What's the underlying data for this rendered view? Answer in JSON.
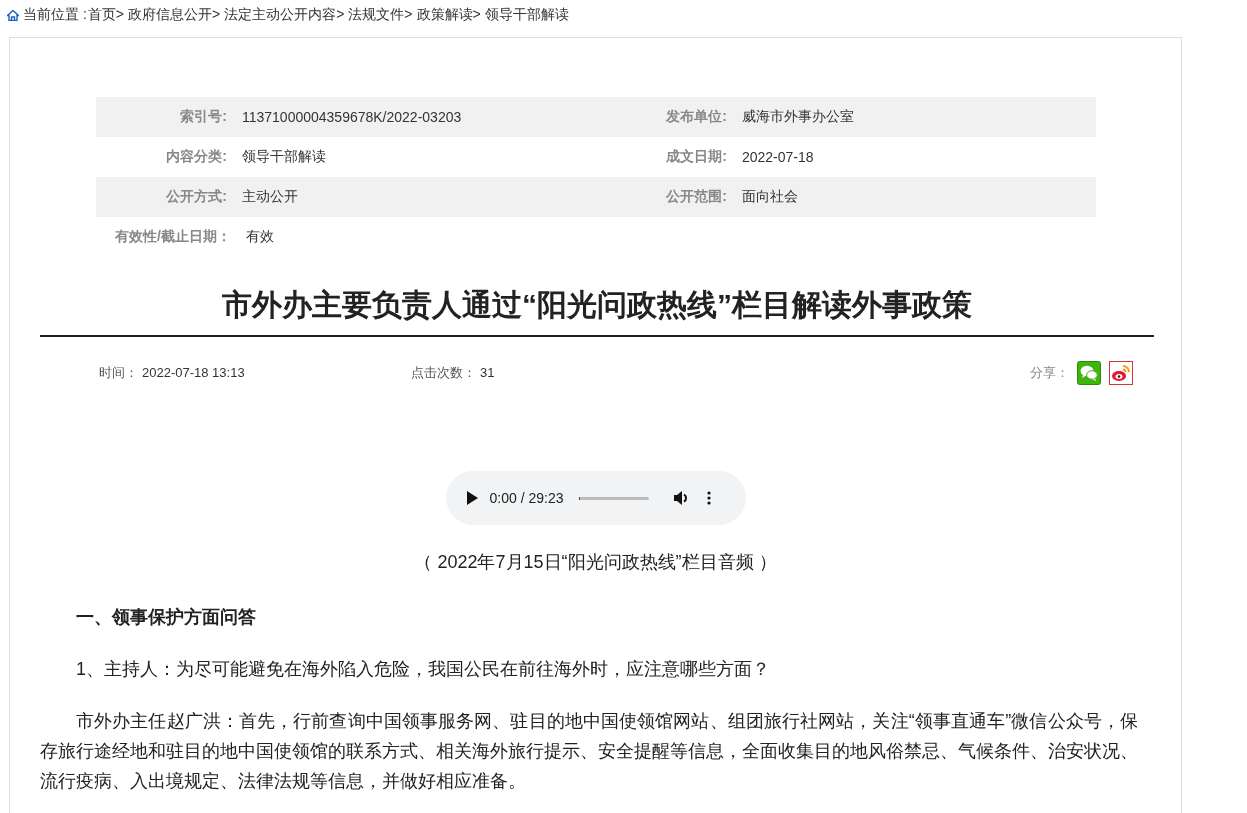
{
  "breadcrumb": {
    "label": "当前位置 :",
    "items": [
      "首页>",
      "政府信息公开>",
      "法定主动公开内容>",
      "法规文件>",
      "政策解读>",
      "领导干部解读"
    ]
  },
  "meta": [
    {
      "label": "索引号:",
      "value": "11371000004359678K/2022-03203",
      "label_2": "发布单位:",
      "value_2": "威海市外事办公室"
    },
    {
      "label": "内容分类:",
      "value": "领导干部解读",
      "label_2": "成文日期:",
      "value_2": "2022-07-18"
    },
    {
      "label": "公开方式:",
      "value": "主动公开",
      "label_2": "公开范围:",
      "value_2": "面向社会"
    },
    {
      "label": "有效性/截止日期：",
      "value": "有效"
    }
  ],
  "article": {
    "title": "市外办主要负责人通过“阳光问政热线”栏目解读外事政策",
    "time_label": "时间：",
    "time": "2022-07-18 13:13",
    "clicks_label": "点击次数：",
    "clicks": "31",
    "share_label": "分享：",
    "audio": {
      "time": "0:00 / 29:23",
      "level": 0
    },
    "caption": "（ 2022年7月15日“阳光问政热线”栏目音频 ）",
    "body": [
      {
        "kind": "heading",
        "text": "一、领事保护方面问答"
      },
      {
        "kind": "paragraph",
        "text": "1、主持人：为尽可能避免在海外陷入危险，我国公民在前往海外时，应注意哪些方面？"
      },
      {
        "kind": "paragraph",
        "text": "市外办主任赵广洪：首先，行前查询中国领事服务网、驻目的地中国使领馆网站、组团旅行社网站，关注“领事直通车”微信公众号，保存旅行途经地和驻目的地中国使领馆的联系方式、相关海外旅行提示、安全提醒等信息，全面收集目的地风俗禁忌、气候条件、治安状况、流行疫病、入出境规定、法律法规等信息，并做好相应准备。"
      }
    ]
  }
}
